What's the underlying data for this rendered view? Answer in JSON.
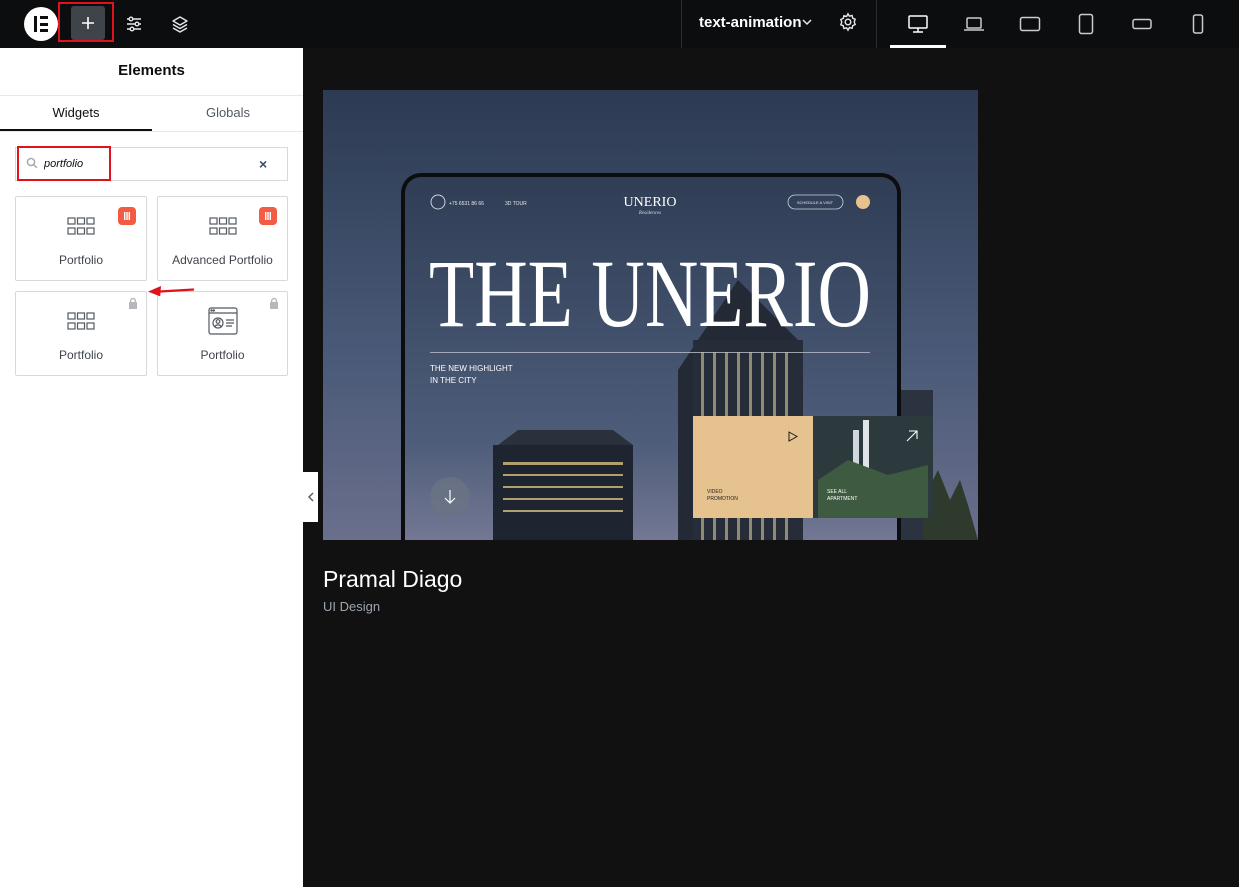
{
  "topbar": {
    "document_title": "text-animation",
    "add_button_glyph": "+",
    "icons": [
      "elementor-logo-icon",
      "plus-icon",
      "sliders-icon",
      "layers-icon",
      "chevron-down-icon",
      "gear-icon"
    ],
    "devices": [
      "desktop-icon",
      "laptop-icon",
      "tablet-landscape-icon",
      "tablet-portrait-icon",
      "mobile-landscape-icon",
      "mobile-portrait-icon"
    ]
  },
  "panel": {
    "title": "Elements",
    "tabs": [
      {
        "label": "Widgets",
        "active": true
      },
      {
        "label": "Globals",
        "active": false
      }
    ],
    "search": {
      "value": "portfolio",
      "clear_glyph": "×"
    },
    "widgets": [
      {
        "label": "Portfolio",
        "badge": true,
        "locked": false
      },
      {
        "label": "Advanced Portfolio",
        "badge": true,
        "locked": false
      },
      {
        "label": "Portfolio",
        "badge": false,
        "locked": true
      },
      {
        "label": "Portfolio",
        "badge": false,
        "locked": true
      }
    ]
  },
  "preview": {
    "mockup_nav_phone": "+75 6531 86 66",
    "mockup_nav_tour": "3D TOUR",
    "mockup_logo": "UNERIO",
    "mockup_logo_sub": "Residences",
    "mockup_nav_button": "SCHEDULE A VISIT",
    "mockup_headline": "THE UNERIO",
    "mockup_tagline_1": "THE NEW HIGHLIGHT",
    "mockup_tagline_2": "IN THE CITY",
    "mockup_card_1_line_1": "VIDEO",
    "mockup_card_1_line_2": "PROMOTION",
    "mockup_card_2_line_1": "SEE ALL",
    "mockup_card_2_line_2": "APARTMENT"
  },
  "project": {
    "title": "Pramal Diago",
    "subtitle": "UI Design"
  },
  "colors": {
    "topbar_bg": "#0c0d0e",
    "canvas_bg": "#111111",
    "highlight_red": "#e0121c",
    "badge_orange": "#f25c44",
    "card_beige": "#e6c28e"
  }
}
